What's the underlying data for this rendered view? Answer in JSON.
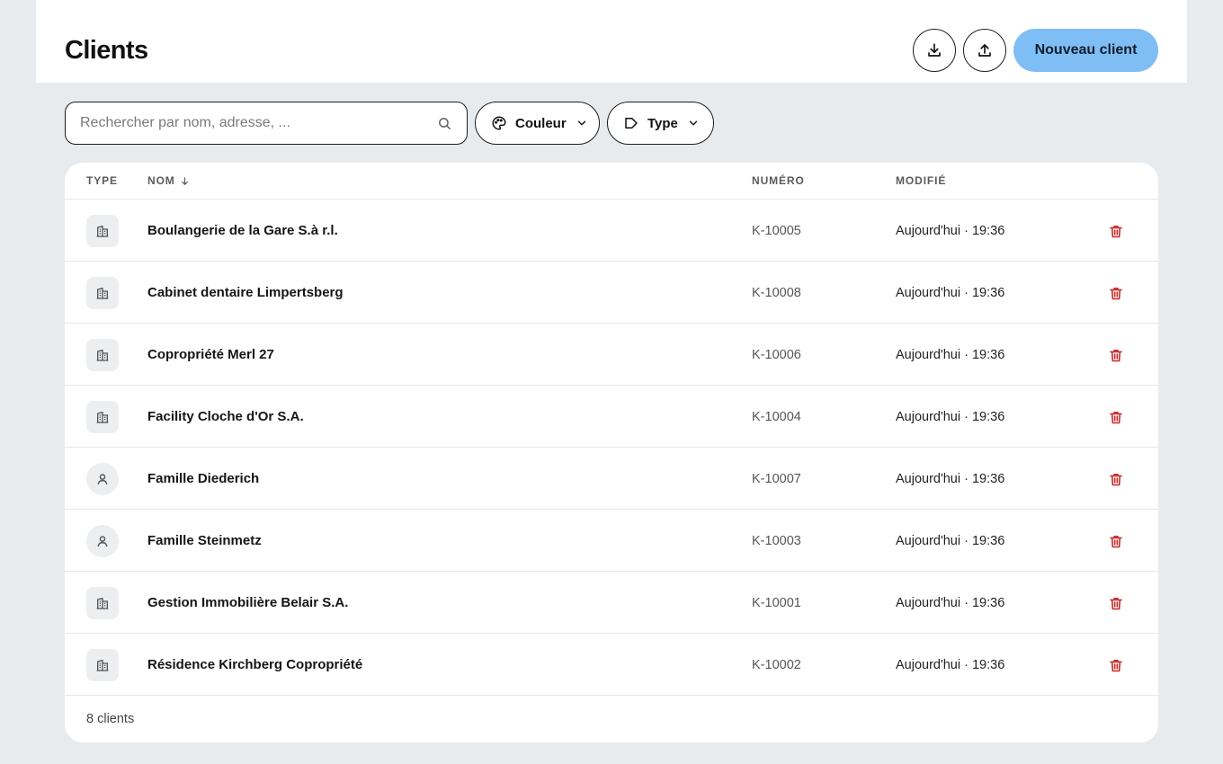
{
  "header": {
    "title": "Clients",
    "new_button_label": "Nouveau client",
    "download_icon": "download-icon",
    "upload_icon": "upload-icon"
  },
  "search": {
    "placeholder": "Rechercher par nom, adresse, ...",
    "value": ""
  },
  "filters": {
    "couleur_label": "Couleur",
    "type_label": "Type"
  },
  "table": {
    "columns": {
      "type": "TYPE",
      "nom": "NOM",
      "numero": "NUMÉRO",
      "modifie": "MODIFIÉ"
    },
    "rows": [
      {
        "type": "company",
        "name": "Boulangerie de la Gare S.à r.l.",
        "number": "K-10005",
        "modified": "Aujourd'hui · 19:36"
      },
      {
        "type": "company",
        "name": "Cabinet dentaire Limpertsberg",
        "number": "K-10008",
        "modified": "Aujourd'hui · 19:36"
      },
      {
        "type": "company",
        "name": "Copropriété Merl 27",
        "number": "K-10006",
        "modified": "Aujourd'hui · 19:36"
      },
      {
        "type": "company",
        "name": "Facility Cloche d'Or S.A.",
        "number": "K-10004",
        "modified": "Aujourd'hui · 19:36"
      },
      {
        "type": "person",
        "name": "Famille Diederich",
        "number": "K-10007",
        "modified": "Aujourd'hui · 19:36"
      },
      {
        "type": "person",
        "name": "Famille Steinmetz",
        "number": "K-10003",
        "modified": "Aujourd'hui · 19:36"
      },
      {
        "type": "company",
        "name": "Gestion Immobilière Belair S.A.",
        "number": "K-10001",
        "modified": "Aujourd'hui · 19:36"
      },
      {
        "type": "company",
        "name": "Résidence Kirchberg Copropriété",
        "number": "K-10002",
        "modified": "Aujourd'hui · 19:36"
      }
    ],
    "footer": "8 clients"
  },
  "colors": {
    "primary": "#7fbdf5",
    "danger": "#c62828",
    "background": "#e7ebee"
  }
}
